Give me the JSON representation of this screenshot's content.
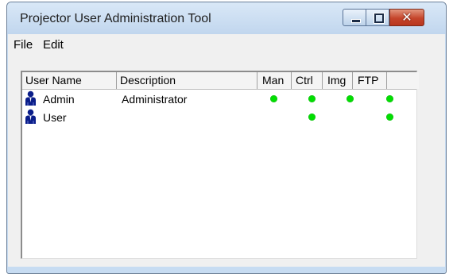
{
  "window": {
    "title": "Projector User Administration Tool"
  },
  "caption_buttons": {
    "minimize_icon": "minimize-icon",
    "maximize_icon": "maximize-icon",
    "close_icon": "close-icon",
    "close_glyph": "✕"
  },
  "menu": {
    "file": "File",
    "edit": "Edit"
  },
  "table": {
    "columns": [
      "User Name",
      "Description",
      "Man",
      "Ctrl",
      "Img",
      "FTP"
    ],
    "rows": [
      {
        "user_name": "Admin",
        "description": "Administrator",
        "man": true,
        "ctrl": true,
        "img": true,
        "ftp": true
      },
      {
        "user_name": "User",
        "description": "",
        "man": false,
        "ctrl": true,
        "img": false,
        "ftp": true
      }
    ]
  },
  "colors": {
    "permission_dot": "#00e000",
    "user_icon": "#0b1e8a"
  }
}
